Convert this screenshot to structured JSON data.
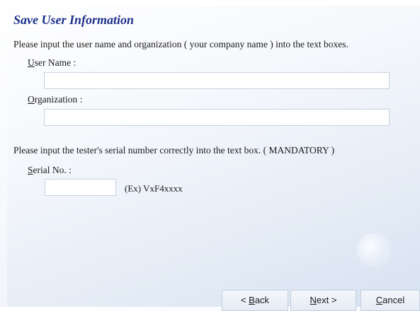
{
  "header": {
    "title": "Save User Information"
  },
  "instructions": {
    "user_info": "Please input the user name and organization ( your company name ) into the text boxes.",
    "serial": "Please input the tester's serial number correctly into the text box. ( MANDATORY )"
  },
  "fields": {
    "user_name": {
      "label_accel": "U",
      "label_rest": "ser Name :",
      "value": "",
      "placeholder": ""
    },
    "organization": {
      "label_accel": "O",
      "label_rest": "rganization :",
      "value": "",
      "placeholder": ""
    },
    "serial_no": {
      "label_accel": "S",
      "label_rest": "erial No. :",
      "value": "",
      "placeholder": "",
      "example": "(Ex) VxF4xxxx"
    }
  },
  "buttons": {
    "back": {
      "prefix": "< ",
      "accel": "B",
      "rest": "ack"
    },
    "next": {
      "accel": "N",
      "rest": "ext >"
    },
    "cancel": {
      "accel": "C",
      "rest": "ancel"
    }
  },
  "colors": {
    "title": "#1d2f8a",
    "background_top": "#ffffff",
    "background_bottom": "#d7e2f1",
    "field_border": "#c8d2e0"
  }
}
